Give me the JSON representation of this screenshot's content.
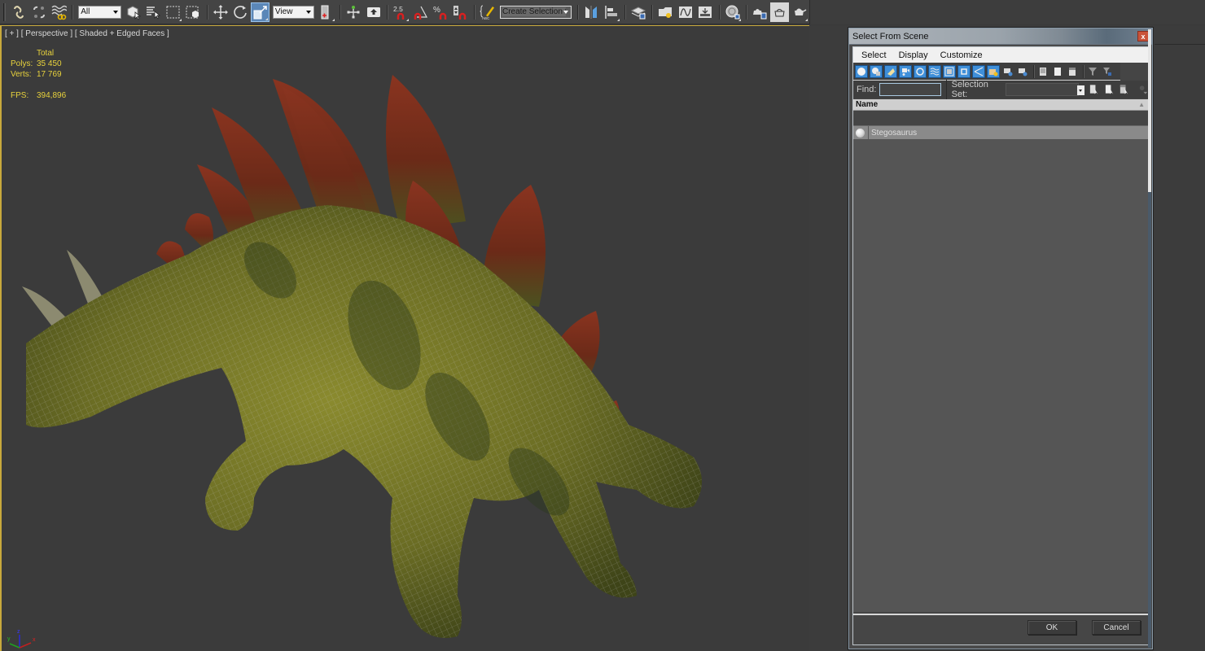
{
  "toolbar": {
    "buttons": [
      {
        "id": "link",
        "icon": "link-icon",
        "label": "Select and Link"
      },
      {
        "id": "unlink",
        "icon": "unlink-icon",
        "label": "Unlink Selection"
      },
      {
        "id": "bind-space-warp",
        "icon": "bind-space-warp-icon",
        "label": "Bind to Space Warp"
      }
    ],
    "selection_filter": "All",
    "reference_coord": "View",
    "snaps_label": "2.5",
    "named_selection_set": "Create Selection Se"
  },
  "viewport": {
    "label_plus": "[ + ]",
    "label_view": "[ Perspective ]",
    "label_shading": "[ Shaded + Edged Faces ]",
    "stats": {
      "header": "Total",
      "polys_label": "Polys:",
      "polys_value": "35 450",
      "verts_label": "Verts:",
      "verts_value": "17 769",
      "fps_label": "FPS:",
      "fps_value": "394,896"
    },
    "axis": {
      "x": "x",
      "y": "y",
      "z": "z"
    },
    "object_name": "Stegosaurus",
    "colors": {
      "background": "#3b3b3b",
      "active_border": "#c8a93c",
      "stats_text": "#e8d23c",
      "body_green": "#6f7226",
      "plate_red": "#7a2e1c",
      "wire": "#b8b8b8"
    }
  },
  "dialog": {
    "title": "Select From Scene",
    "close_label": "x",
    "menu": [
      "Select",
      "Display",
      "Customize"
    ],
    "filters": [
      {
        "icon": "geometry-filter-icon",
        "active": true
      },
      {
        "icon": "shapes-filter-icon",
        "active": true
      },
      {
        "icon": "lights-filter-icon",
        "active": true
      },
      {
        "icon": "cameras-filter-icon",
        "active": true
      },
      {
        "icon": "helpers-filter-icon",
        "active": true
      },
      {
        "icon": "space-warps-filter-icon",
        "active": true
      },
      {
        "icon": "groups-filter-icon",
        "active": true
      },
      {
        "icon": "xrefs-filter-icon",
        "active": true
      },
      {
        "icon": "bones-filter-icon",
        "active": true
      },
      {
        "icon": "containers-filter-icon",
        "active": true
      },
      {
        "icon": "frozen-filter-icon",
        "active": false
      },
      {
        "icon": "hidden-filter-icon",
        "active": false
      }
    ],
    "find_label": "Find:",
    "find_value": "",
    "selection_set_label": "Selection Set:",
    "selection_set_value": "",
    "column_name": "Name",
    "rows": [
      {
        "name": "Stegosaurus",
        "selected": true
      }
    ],
    "ok_label": "OK",
    "cancel_label": "Cancel",
    "accent": "#3f8fd9"
  }
}
